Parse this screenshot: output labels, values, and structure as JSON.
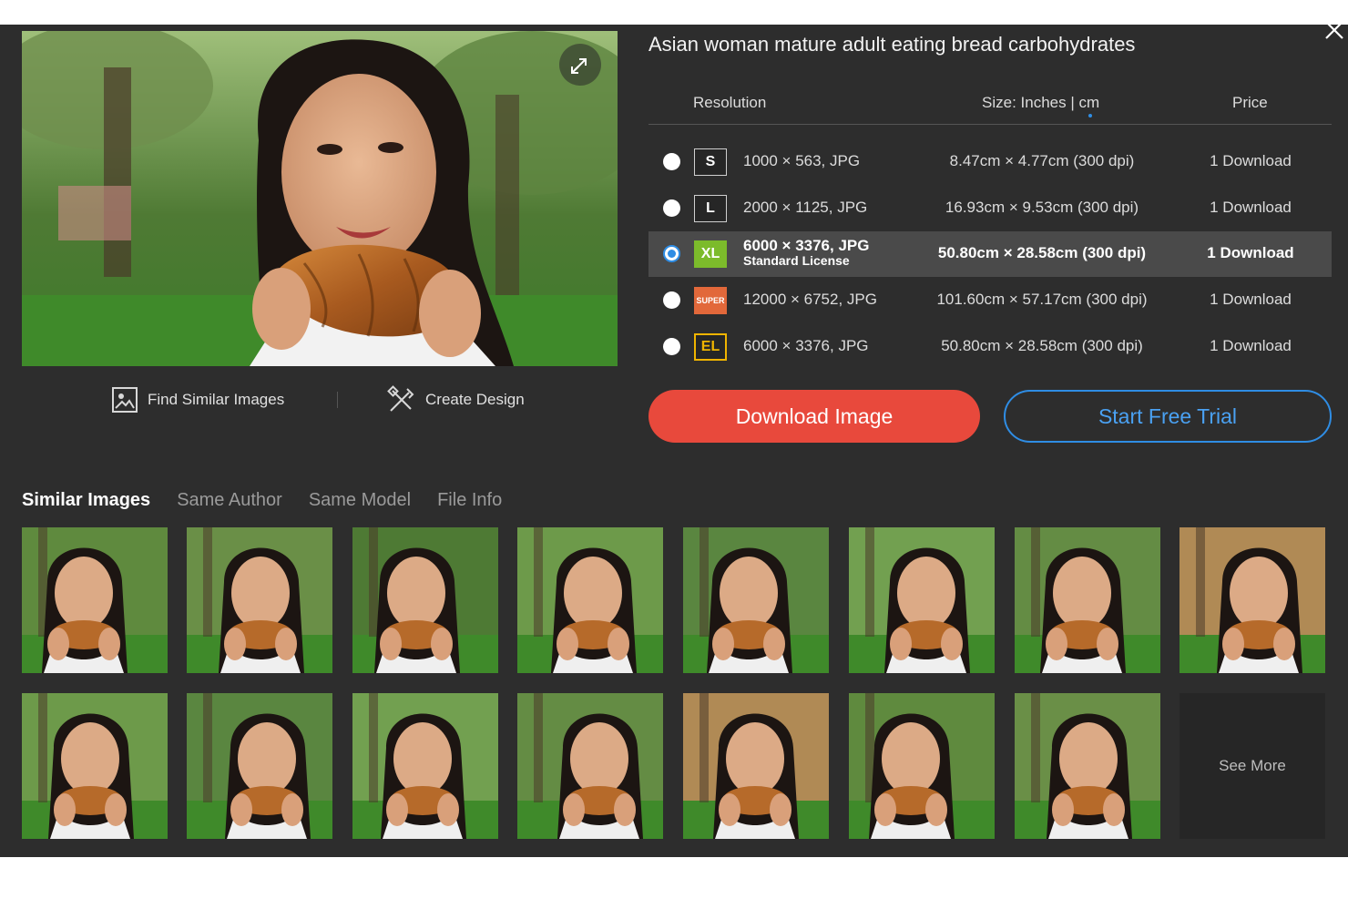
{
  "title": "Asian woman mature adult eating bread carbohydrates",
  "table": {
    "headers": {
      "resolution": "Resolution",
      "size": "Size: Inches | cm",
      "price": "Price"
    },
    "rows": [
      {
        "badge": "S",
        "resolution": "1000 × 563, JPG",
        "size": "8.47cm × 4.77cm (300 dpi)",
        "price": "1 Download"
      },
      {
        "badge": "L",
        "resolution": "2000 × 1125, JPG",
        "size": "16.93cm × 9.53cm (300 dpi)",
        "price": "1 Download"
      },
      {
        "badge": "XL",
        "resolution": "6000 × 3376, JPG",
        "license": "Standard License",
        "size": "50.80cm × 28.58cm (300 dpi)",
        "price": "1 Download",
        "selected": true
      },
      {
        "badge": "SUPER",
        "resolution": "12000 × 6752, JPG",
        "size": "101.60cm × 57.17cm (300 dpi)",
        "price": "1 Download"
      },
      {
        "badge": "EL",
        "resolution": "6000 × 3376, JPG",
        "size": "50.80cm × 28.58cm (300 dpi)",
        "price": "1 Download"
      }
    ]
  },
  "tools": {
    "find_similar": "Find Similar Images",
    "create_design": "Create Design"
  },
  "buttons": {
    "download": "Download Image",
    "trial": "Start Free Trial"
  },
  "tabs": [
    {
      "label": "Similar Images",
      "active": true
    },
    {
      "label": "Same Author"
    },
    {
      "label": "Same Model"
    },
    {
      "label": "File Info"
    }
  ],
  "see_more": "See More",
  "colors": {
    "panel_bg": "#2d2d2d",
    "download_button": "#e8493c",
    "trial_accent": "#2f8de4",
    "badge_xl": "#7cbb2b",
    "badge_super": "#e2683a",
    "badge_el": "#f0b400"
  },
  "icons": {
    "close": "close-icon",
    "expand": "expand-icon",
    "find_similar": "image-search-icon",
    "create_design": "design-tools-icon"
  }
}
